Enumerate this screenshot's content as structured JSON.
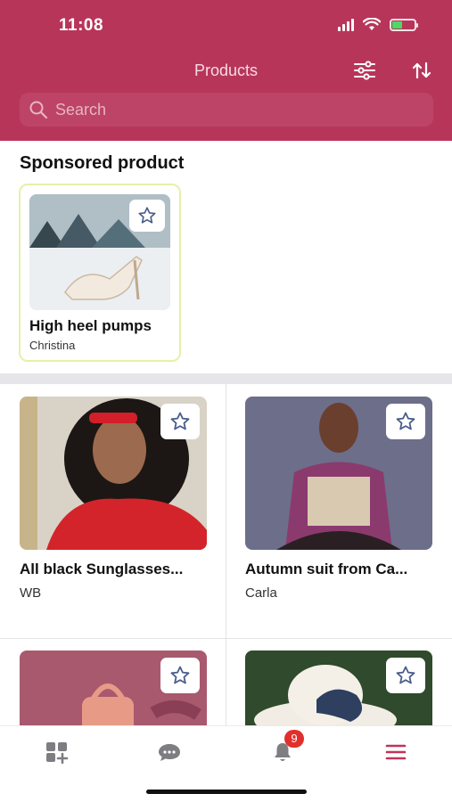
{
  "status_bar": {
    "time": "11:08"
  },
  "header": {
    "title": "Products",
    "filter_icon": "sliders-icon",
    "sort_icon": "sort-arrows-icon"
  },
  "search": {
    "placeholder": "Search",
    "icon": "search-icon"
  },
  "sponsored": {
    "section_title": "Sponsored product",
    "product": {
      "title": "High heel pumps",
      "seller": "Christina",
      "icon": "star-icon"
    }
  },
  "products": [
    {
      "title": "All black Sunglasses...",
      "seller": "WB"
    },
    {
      "title": "Autumn suit from Ca...",
      "seller": "Carla"
    },
    {
      "title": "",
      "seller": ""
    },
    {
      "title": "",
      "seller": ""
    }
  ],
  "tabbar": {
    "items": [
      {
        "name": "products",
        "icon": "grid-plus-icon"
      },
      {
        "name": "messages",
        "icon": "chat-bubble-icon"
      },
      {
        "name": "notifications",
        "icon": "bell-icon",
        "badge": "9"
      },
      {
        "name": "menu",
        "icon": "hamburger-menu-icon"
      }
    ]
  },
  "colors": {
    "brand": "#b8355a",
    "badge": "#e0302c",
    "active_tab": "#c0345a",
    "sponsored_border": "#e3f2a8"
  }
}
